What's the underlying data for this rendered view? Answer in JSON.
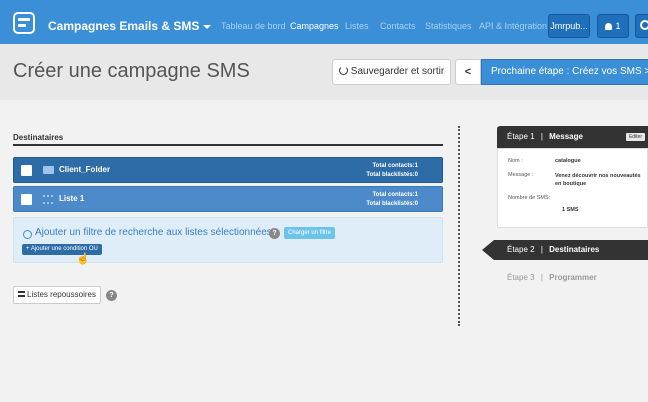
{
  "topbar": {
    "brand": "Campagnes Emails & SMS",
    "nav": [
      "Tableau de bord",
      "Campagnes",
      "Listes",
      "Contacts",
      "Statistiques",
      "API & Intégration"
    ],
    "active_nav": "Campagnes",
    "user_label": "Jmrpub...",
    "notif_count": "1"
  },
  "header": {
    "title": "Créer une campagne SMS",
    "save_label": "Sauvegarder et sortir",
    "prev_label": "<",
    "next_label": "Prochaine étape : Créez vos SMS >"
  },
  "recipients": {
    "section_title": "Destinataires",
    "lists": [
      {
        "name": "Client_Folder",
        "contacts": "Total contacts:1",
        "blacklisted": "Total blacklistés:0",
        "icon": "folder-icon"
      },
      {
        "name": "Liste 1",
        "contacts": "Total contacts:1",
        "blacklisted": "Total blacklistés:0",
        "icon": "list-icon"
      }
    ],
    "filter_text": "Ajouter un filtre de recherche aux listes sélectionnées",
    "help": "?",
    "load_filter_label": "Charger un filtre",
    "add_or_label": "+ Ajouter une condition OU",
    "repousse_label": "Listes repoussoires"
  },
  "steps": {
    "step1": {
      "number": "Étape 1",
      "sep": "|",
      "name": "Message",
      "edit_label": "Editer",
      "fields": [
        {
          "label": "Nom :",
          "value": "catalogue"
        },
        {
          "label": "Message :",
          "value": "Venez découvrir nos nouveautés en boutique"
        },
        {
          "label": "Nombre de SMS:",
          "value": "1 SMS"
        }
      ]
    },
    "step2": {
      "number": "Étape 2",
      "sep": "|",
      "name": "Destinataires"
    },
    "step3": {
      "number": "Étape 3",
      "sep": "|",
      "name": "Programmer"
    }
  },
  "colors": {
    "primary": "#3b8fd6",
    "dark_row": "#2e6ca8",
    "light_row": "#4c8ac9",
    "step_dark": "#333333"
  }
}
